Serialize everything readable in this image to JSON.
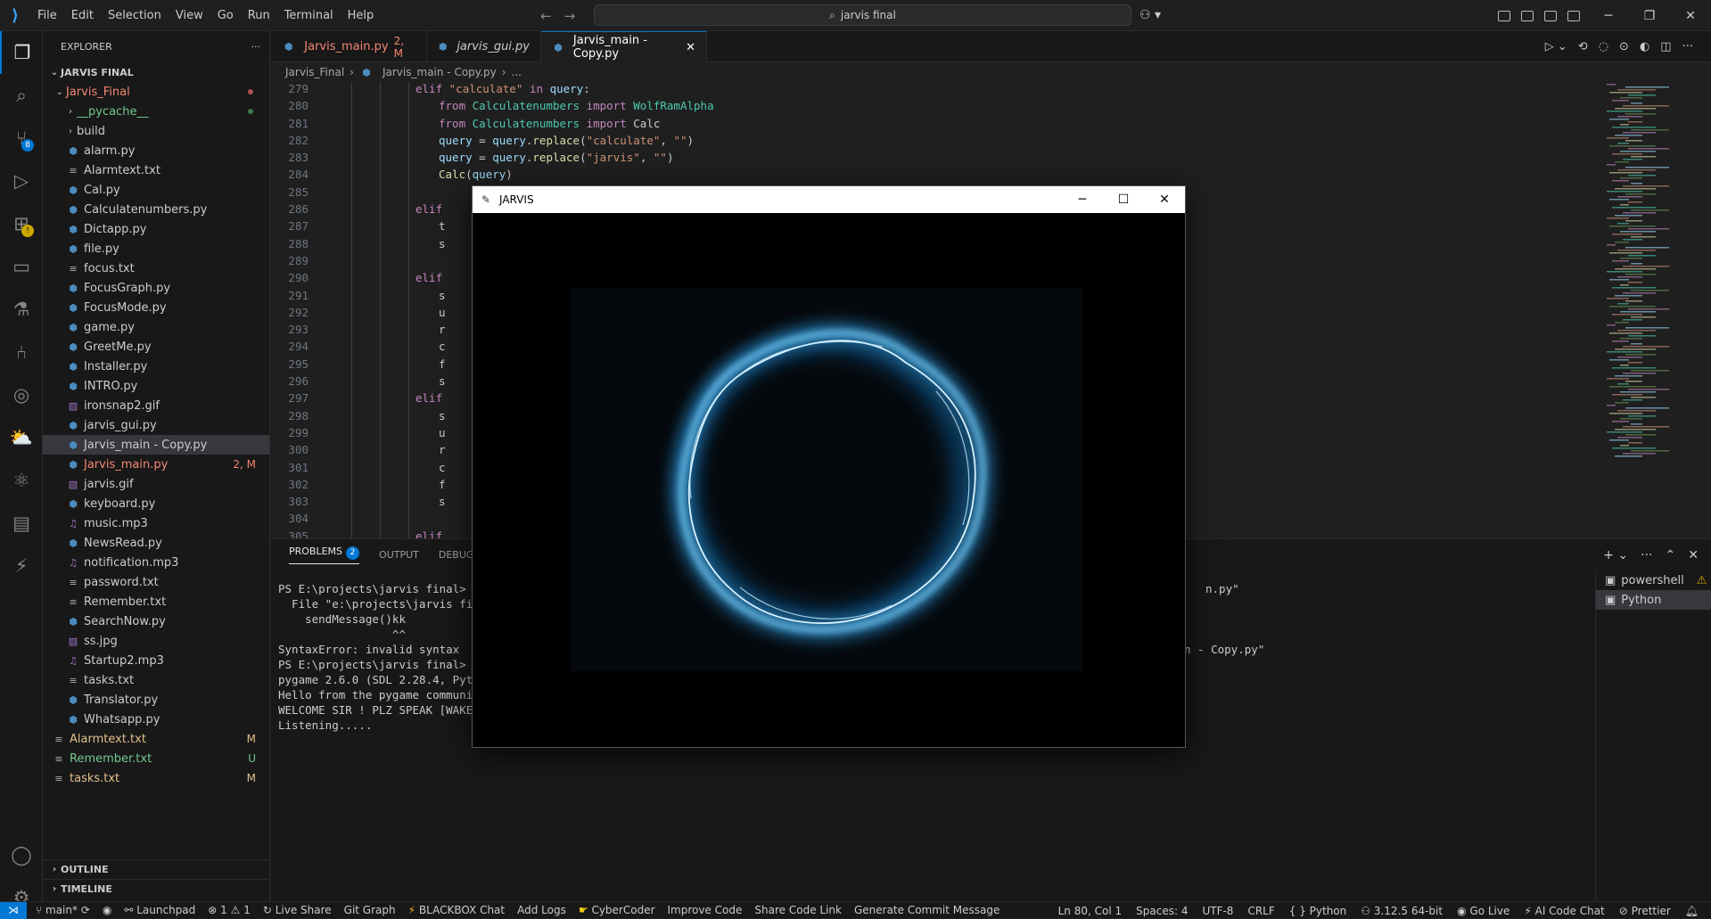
{
  "menu": [
    "File",
    "Edit",
    "Selection",
    "View",
    "Go",
    "Run",
    "Terminal",
    "Help"
  ],
  "search": {
    "text": "jarvis final"
  },
  "explorer": {
    "title": "EXPLORER",
    "root": "JARVIS FINAL",
    "folder": "Jarvis_Final",
    "items": [
      {
        "name": "__pycache__",
        "type": "folder",
        "dec": "",
        "color": "#73c991"
      },
      {
        "name": "build",
        "type": "folder",
        "dec": ""
      },
      {
        "name": "alarm.py",
        "type": "py",
        "dec": ""
      },
      {
        "name": "Alarmtext.txt",
        "type": "txt",
        "dec": ""
      },
      {
        "name": "Cal.py",
        "type": "py",
        "dec": ""
      },
      {
        "name": "Calculatenumbers.py",
        "type": "py",
        "dec": ""
      },
      {
        "name": "Dictapp.py",
        "type": "py",
        "dec": ""
      },
      {
        "name": "file.py",
        "type": "py",
        "dec": ""
      },
      {
        "name": "focus.txt",
        "type": "txt",
        "dec": ""
      },
      {
        "name": "FocusGraph.py",
        "type": "py",
        "dec": ""
      },
      {
        "name": "FocusMode.py",
        "type": "py",
        "dec": ""
      },
      {
        "name": "game.py",
        "type": "py",
        "dec": ""
      },
      {
        "name": "GreetMe.py",
        "type": "py",
        "dec": ""
      },
      {
        "name": "Installer.py",
        "type": "py",
        "dec": ""
      },
      {
        "name": "INTRO.py",
        "type": "py",
        "dec": ""
      },
      {
        "name": "ironsnap2.gif",
        "type": "gif",
        "dec": ""
      },
      {
        "name": "jarvis_gui.py",
        "type": "py",
        "dec": ""
      },
      {
        "name": "Jarvis_main - Copy.py",
        "type": "py",
        "dec": "",
        "selected": true
      },
      {
        "name": "Jarvis_main.py",
        "type": "py",
        "dec": "2, M",
        "color": "#f48771"
      },
      {
        "name": "jarvis.gif",
        "type": "gif",
        "dec": ""
      },
      {
        "name": "keyboard.py",
        "type": "py",
        "dec": ""
      },
      {
        "name": "music.mp3",
        "type": "mp3",
        "dec": ""
      },
      {
        "name": "NewsRead.py",
        "type": "py",
        "dec": ""
      },
      {
        "name": "notification.mp3",
        "type": "mp3",
        "dec": ""
      },
      {
        "name": "password.txt",
        "type": "txt",
        "dec": ""
      },
      {
        "name": "Remember.txt",
        "type": "txt",
        "dec": ""
      },
      {
        "name": "SearchNow.py",
        "type": "py",
        "dec": ""
      },
      {
        "name": "ss.jpg",
        "type": "jpg",
        "dec": ""
      },
      {
        "name": "Startup2.mp3",
        "type": "mp3",
        "dec": ""
      },
      {
        "name": "tasks.txt",
        "type": "txt",
        "dec": ""
      },
      {
        "name": "Translator.py",
        "type": "py",
        "dec": ""
      },
      {
        "name": "Whatsapp.py",
        "type": "py",
        "dec": ""
      }
    ],
    "rootItems": [
      {
        "name": "Alarmtext.txt",
        "dec": "M",
        "color": "#e2c08d"
      },
      {
        "name": "Remember.txt",
        "dec": "U",
        "color": "#73c991"
      },
      {
        "name": "tasks.txt",
        "dec": "M",
        "color": "#e2c08d"
      }
    ],
    "outline": "OUTLINE",
    "timeline": "TIMELINE"
  },
  "tabs": [
    {
      "label": "Jarvis_main.py",
      "dec": "2, M"
    },
    {
      "label": "jarvis_gui.py",
      "dec": ""
    },
    {
      "label": "Jarvis_main - Copy.py",
      "dec": ""
    }
  ],
  "breadcrumb": {
    "folder": "Jarvis_Final",
    "file": "Jarvis_main - Copy.py",
    "tail": "..."
  },
  "code": [
    {
      "n": "279",
      "t": "elif \"calculate\" in query:"
    },
    {
      "n": "280",
      "t": "from Calculatenumbers import WolfRamAlpha"
    },
    {
      "n": "281",
      "t": "from Calculatenumbers import Calc"
    },
    {
      "n": "282",
      "t": "query = query.replace(\"calculate\", \"\")"
    },
    {
      "n": "283",
      "t": "query = query.replace(\"jarvis\", \"\")"
    },
    {
      "n": "284",
      "t": "Calc(query)"
    },
    {
      "n": "285",
      "t": ""
    },
    {
      "n": "286",
      "t": "elif"
    },
    {
      "n": "287",
      "t": "t"
    },
    {
      "n": "288",
      "t": "s"
    },
    {
      "n": "289",
      "t": ""
    },
    {
      "n": "290",
      "t": "elif"
    },
    {
      "n": "291",
      "t": "s"
    },
    {
      "n": "292",
      "t": "u"
    },
    {
      "n": "293",
      "t": "r"
    },
    {
      "n": "294",
      "t": "c"
    },
    {
      "n": "295",
      "t": "f"
    },
    {
      "n": "296",
      "t": "s"
    },
    {
      "n": "297",
      "t": "elif"
    },
    {
      "n": "298",
      "t": "s"
    },
    {
      "n": "299",
      "t": "u"
    },
    {
      "n": "300",
      "t": "r"
    },
    {
      "n": "301",
      "t": "c"
    },
    {
      "n": "302",
      "t": "f"
    },
    {
      "n": "303",
      "t": "s"
    },
    {
      "n": "304",
      "t": ""
    },
    {
      "n": "305",
      "t": "elif"
    }
  ],
  "panel": {
    "problems": "PROBLEMS",
    "problemsCount": "2",
    "output": "OUTPUT",
    "debug": "DEBUG C",
    "terminal": [
      "PS E:\\projects\\jarvis final> &",
      "  File \"e:\\projects\\jarvis fi",
      "    sendMessage()kk",
      "                 ^^",
      "SyntaxError: invalid syntax",
      "PS E:\\projects\\jarvis final> &",
      "pygame 2.6.0 (SDL 2.28.4, Pyth",
      "Hello from the pygame communit",
      "WELCOME SIR ! PLZ SPEAK [WAKE",
      "Listening....."
    ],
    "termRight1": "n.py\"",
    "termRight2": "n - Copy.py\"",
    "shells": [
      {
        "name": "powershell"
      },
      {
        "name": "Python"
      }
    ]
  },
  "jarvis": {
    "title": "JARVIS"
  },
  "status": {
    "branch": "main*",
    "launchpad": "Launchpad",
    "errors": "1",
    "warnings": "1",
    "liveshare": "Live Share",
    "gitgraph": "Git Graph",
    "blackbox": "BLACKBOX Chat",
    "addlogs": "Add Logs",
    "cybercoder": "CyberCoder",
    "improve": "Improve Code",
    "share": "Share Code Link",
    "commit": "Generate Commit Message",
    "pos": "Ln 80, Col 1",
    "spaces": "Spaces: 4",
    "enc": "UTF-8",
    "eol": "CRLF",
    "lang": "Python",
    "py": "3.12.5 64-bit",
    "golive": "Go Live",
    "aichat": "AI Code Chat",
    "prettier": "Prettier"
  }
}
